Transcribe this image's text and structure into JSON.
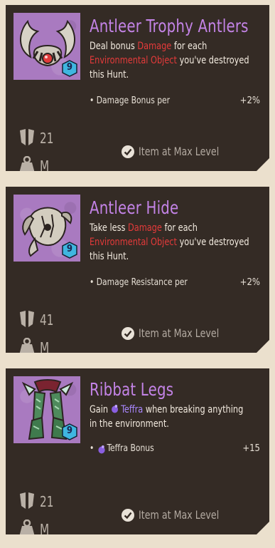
{
  "colors": {
    "background": "#ebe0cd",
    "card": "#342b25",
    "title": "#c383e6",
    "damage_keyword": "#e43a3a",
    "teffra_keyword": "#a987ff",
    "thumbnail_bg": "#a97ac0",
    "level_badge": "#3fb6e0"
  },
  "cards": [
    {
      "title": "Antleer Trophy Antlers",
      "level": "9",
      "desc": {
        "p1": "Deal bonus ",
        "k1": "Damage",
        "p2": " for each ",
        "k2": "Environmental Object",
        "p3": " you've destroyed this Hunt."
      },
      "bonus_label": "• Damage Bonus per",
      "bonus_value": "+2%",
      "stat_value": "21",
      "weight_class": "M",
      "max_level_text": "Item at Max Level",
      "icon": "antlers-icon"
    },
    {
      "title": "Antleer Hide",
      "level": "9",
      "desc": {
        "p1": "Take less ",
        "k1": "Damage",
        "p2": " for each ",
        "k2": "Environmental Object",
        "p3": " you've destroyed this Hunt."
      },
      "bonus_label": "• Damage Resistance per",
      "bonus_value": "+2%",
      "stat_value": "41",
      "weight_class": "M",
      "max_level_text": "Item at Max Level",
      "icon": "hide-armor-icon"
    },
    {
      "title": "Ribbat Legs",
      "level": "9",
      "desc": {
        "p1": "Gain ",
        "k1": "Teffra",
        "p2": " when breaking anything in the environment.",
        "k2": "",
        "p3": ""
      },
      "bonus_label": "• Teffra Bonus",
      "bonus_value": "+15",
      "stat_value": "21",
      "weight_class": "M",
      "max_level_text": "Item at Max Level",
      "icon": "legs-armor-icon"
    }
  ]
}
